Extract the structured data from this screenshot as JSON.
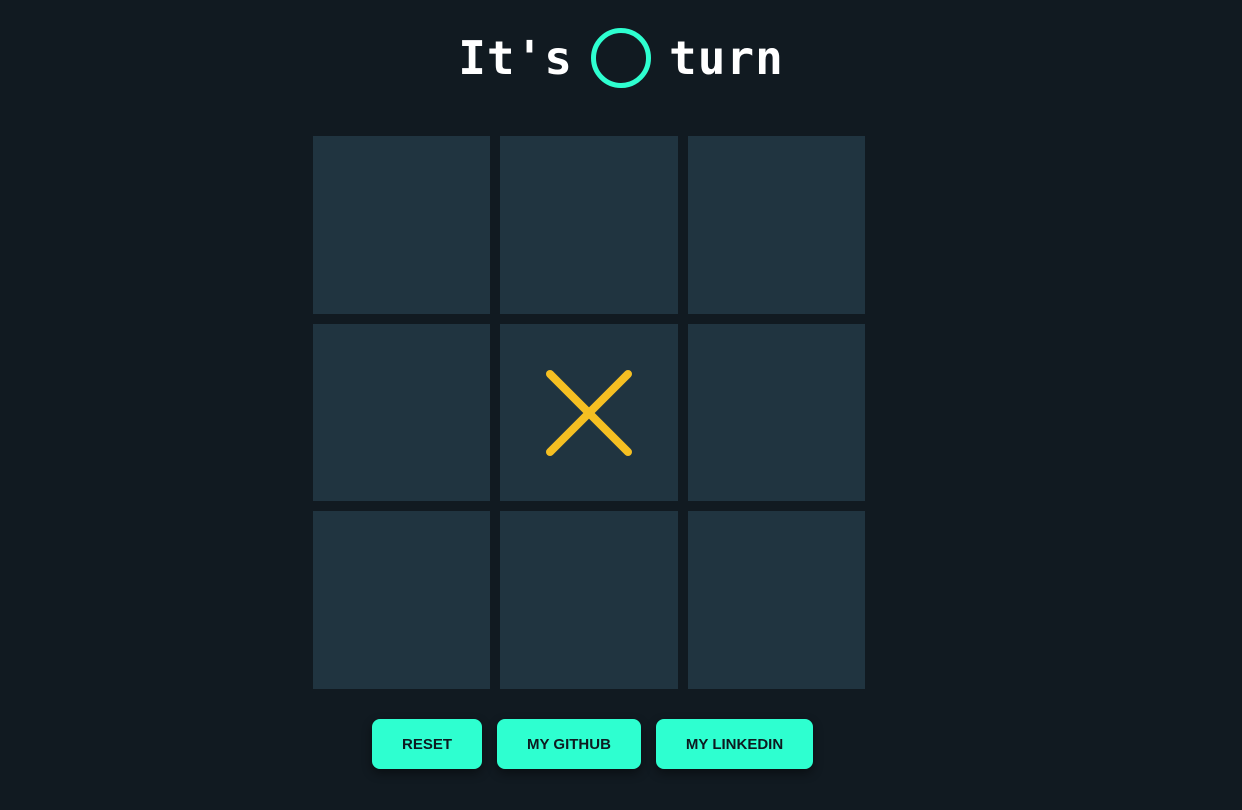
{
  "header": {
    "prefix": "It's",
    "current_player_icon": "circle-o-icon",
    "suffix": "turn"
  },
  "board": {
    "cells": [
      "",
      "",
      "",
      "",
      "X",
      "",
      "",
      "",
      ""
    ]
  },
  "buttons": {
    "reset_label": "RESET",
    "github_label": "MY GITHUB",
    "linkedin_label": "MY LINKEDIN"
  },
  "colors": {
    "background": "#111a21",
    "cell": "#203440",
    "x_mark": "#f5bf22",
    "o_mark": "#2effd0",
    "button": "#2effd0"
  }
}
